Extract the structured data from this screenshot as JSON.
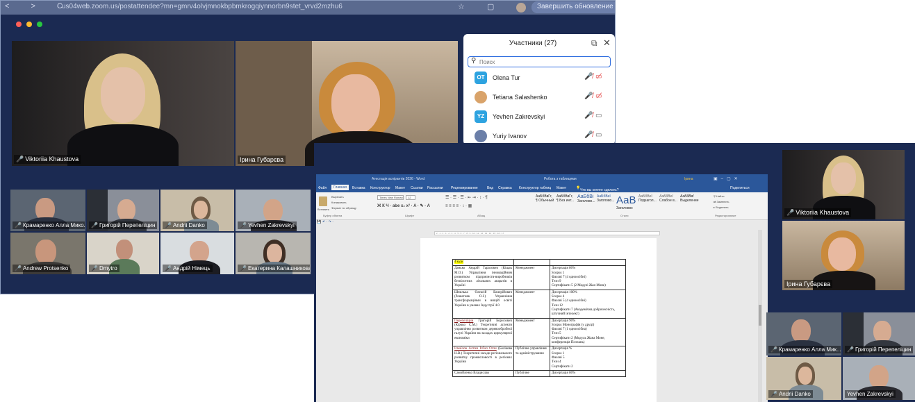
{
  "browser": {
    "url": "us04web.zoom.us/postattendee?mn=gmrv4olvjmnokbpbmkrogqiynnorbn9stet_vrvd2mzhu6",
    "nav_icons": "< > C ⌂",
    "update_button": "Завершить обновление"
  },
  "meeting1": {
    "tiles_big": [
      {
        "name": "Viktoriia Khaustova",
        "pinned": true
      },
      {
        "name": "Ірина Губарєва",
        "pinned": false
      }
    ],
    "tiles_small": [
      {
        "name": "Крамаренко Алла Мико..."
      },
      {
        "name": "Григорій Перепеліцин"
      },
      {
        "name": "Andrii Danko"
      },
      {
        "name": "Yevhen Zakrevskyi"
      },
      {
        "name": "Andrew Protsenko"
      },
      {
        "name": "Dmytro"
      },
      {
        "name": "Андрій Німець"
      },
      {
        "name": "Екатерина Калашникова"
      }
    ]
  },
  "participants_panel": {
    "title": "Участники (27)",
    "popout_icon": "⧉",
    "close_icon": "✕",
    "search_placeholder": "Поиск",
    "items": [
      {
        "initials": "OT",
        "name": "Olena Tur",
        "color": "#2ea3e0",
        "cam_off": true
      },
      {
        "initials": "",
        "name": "Tetiana Salashenko",
        "color": "#d9a36a",
        "cam_off": true
      },
      {
        "initials": "YZ",
        "name": "Yevhen Zakrevskyi",
        "color": "#2ea3e0",
        "cam_off": false
      },
      {
        "initials": "",
        "name": "Yuriy Ivanov",
        "color": "#6b7fa8",
        "cam_off": false
      }
    ]
  },
  "word": {
    "window_title": "Атестація аспірантів 2026 - Word",
    "context_title": "Робота з таблицями",
    "user": "Ірина",
    "menu": [
      "Файл",
      "Главная",
      "Вставка",
      "Конструктор",
      "Макет",
      "Ссылки",
      "Рассылки",
      "Рецензирование",
      "Вид",
      "Справка",
      "Конструктор таблиц",
      "Макет",
      "Что вы хотите сделать?",
      "Поделиться"
    ],
    "font_name": "Times New Roman",
    "font_size": "12",
    "clipboard_items": [
      "Вырезать",
      "Копировать",
      "Формат по образцу"
    ],
    "paste_label": "Вставить",
    "groups": [
      "Буфер обмена",
      "Шрифт",
      "Абзац",
      "Стили",
      "Редактирование"
    ],
    "styles": [
      "АаБбВвГг,",
      "АаБбВвГг,",
      "АаБбВі",
      "АаБбВеІ",
      "АаВ",
      "АаБбВеІ",
      "АаБбВеІ",
      "АаБбВвІ"
    ],
    "style_names": [
      "¶ Обычный",
      "¶ Без инт...",
      "Заголово...",
      "Заголово...",
      "Заголовок",
      "Подзагол...",
      "Слабое в...",
      "Выделение"
    ],
    "editing": [
      "Найти",
      "Заменить",
      "Выделить"
    ],
    "ruler_text": "2 · 1 · 1 · 1 · 2 · 3 · 4 · 5 · 6 · 7 · 8 · 9 · 10 · 11 · 12 · 13 · 14 · 15 · 16 · 17",
    "table": {
      "header": "4 курс",
      "rows": [
        {
          "col1_red": "",
          "col1": "Данько Андрій Тарасович (Кіщак М.О.) Управління інноваційним розвитком підприємств-виробників безпілотних літальних апаратів в Україні",
          "col2": "Менеджмент",
          "col3": [
            "Дисертація 80%",
            "Scopus 1",
            "Фахові 7 (4 одноосібні)",
            "Тези 9",
            "Сертифікати 5 (2 Модулі Жан Моне)"
          ]
        },
        {
          "col1_red": "",
          "col1": "Шпилька Олексій Валерійович (Решетняк О.І.) Управління трансформаціями в вищій освіті України в умовах Індустрії 4.0",
          "col2": "Менеджмент",
          "col3": [
            "Дисертація 100%",
            "Scopus 4",
            "Фахові 5 (4 одноосібні)",
            "Тези 12",
            "Сертифікати 7 (Академічна доброчесність, штучний інтелект)"
          ]
        },
        {
          "col1_red": "Перепеліцин",
          "col1": "Григорій Борисович (Кірчко С.М.) Теоретичні аспекти управління розвитком деревообробної галузі України на засадах циркулярної економіки",
          "col2": "Менеджмент",
          "col3": [
            "Дисертація 90%",
            "Scopus Монографія (у друці)",
            "Фахові 7 (1 одноосібна)",
            "Тези 5",
            "Сертифікати 2 (Модуль Жана Моне, конференція Познань)"
          ]
        },
        {
          "col1_red": "Ісмаїлов Алтин Ісбал Огли",
          "col1": "(Белікова Н.В.) Теоретичні засади регіонального розвитку промисловості в регіонах України",
          "col2": "Публічне управління та адміністрування",
          "col3": [
            "Дисертація %",
            "Scopus 1",
            "Фахові 5",
            "Тези 4",
            "Сертифікати 2"
          ]
        },
        {
          "col1_red": "",
          "col1": "Самойленко Владислав",
          "col2": "Публічне",
          "col3": [
            "Дисертація 80%"
          ]
        }
      ]
    }
  },
  "meeting2": {
    "tiles_big": [
      {
        "name": "Viktoriia Khaustova"
      },
      {
        "name": "Ірина Губарєва"
      }
    ],
    "tiles_small": [
      {
        "name": "Крамаренко Алла Мик..."
      },
      {
        "name": "Григорій Перепеліцин"
      },
      {
        "name": "Andrii Danko"
      },
      {
        "name": "Yevhen Zakrevskyi"
      }
    ]
  }
}
